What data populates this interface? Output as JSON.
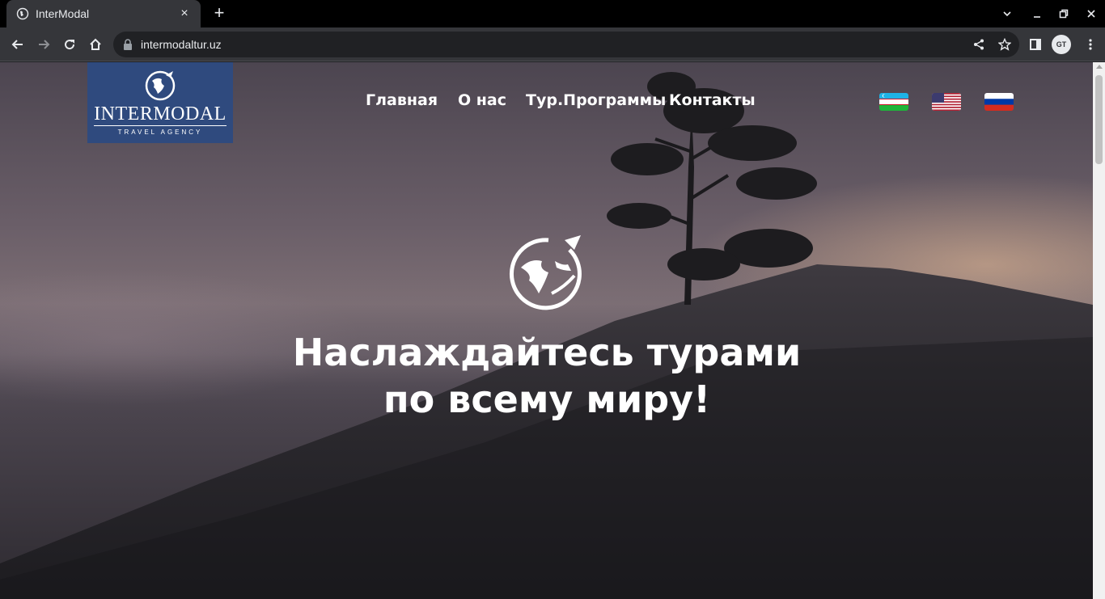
{
  "browser": {
    "tab_title": "InterModal",
    "tab_close": "×",
    "new_tab": "+",
    "url": "intermodaltur.uz",
    "profile_initials": "GT"
  },
  "site": {
    "logo": {
      "brand": "INTERMODAL",
      "tagline": "TRAVEL AGENCY"
    },
    "nav": [
      {
        "label": "Главная"
      },
      {
        "label": "О нас"
      },
      {
        "label": "Тур.Программы"
      },
      {
        "label": "Контакты"
      }
    ],
    "languages": [
      "uz",
      "en",
      "ru"
    ],
    "hero": {
      "headline_line1": "Наслаждайтесь турами",
      "headline_line2": "по всему миру!"
    }
  },
  "colors": {
    "logo_bg": "#2f4a7e",
    "tab_bg": "#35363a",
    "chrome_bg": "#000000"
  }
}
